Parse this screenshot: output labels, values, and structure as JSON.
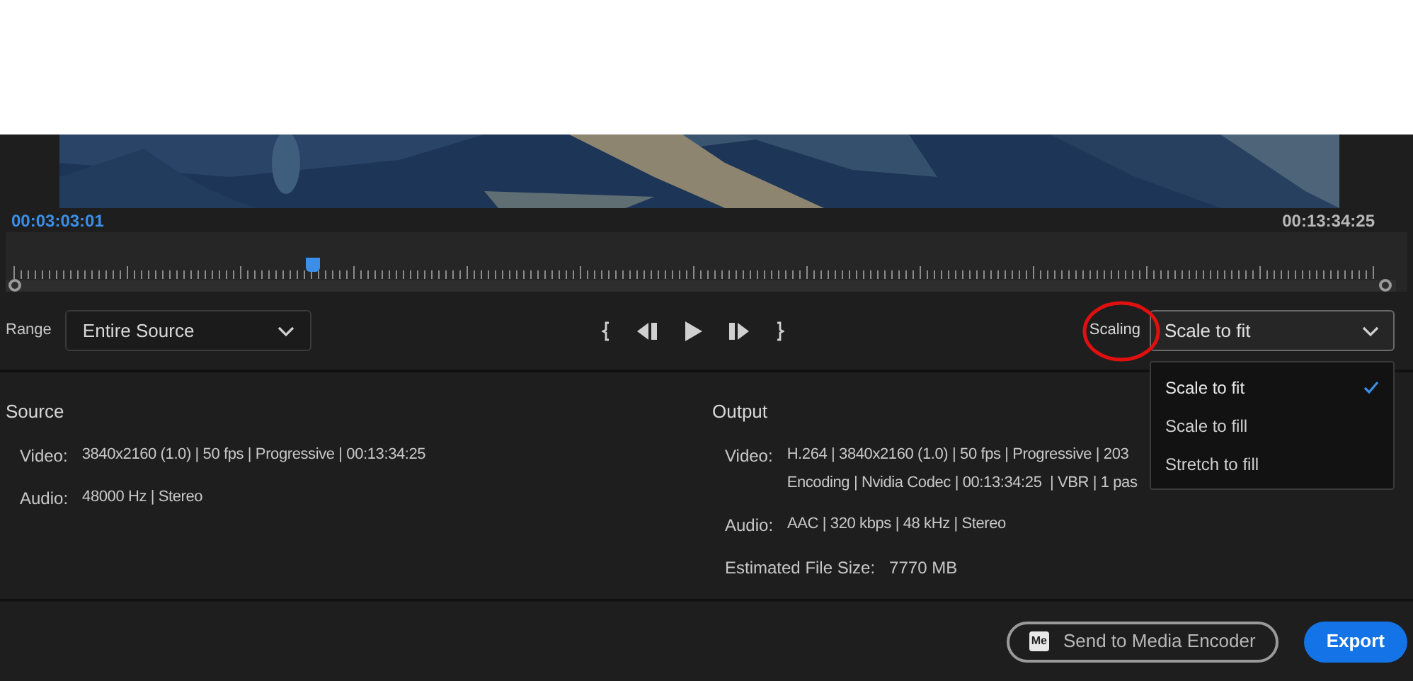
{
  "timeline": {
    "current_time": "00:03:03:01",
    "duration": "00:13:34:25",
    "level": 0.22
  },
  "range": {
    "label": "Range",
    "value": "Entire Source"
  },
  "scaling": {
    "label": "Scaling",
    "value": "Scale to fit",
    "expanded": true,
    "options": [
      {
        "label": "Scale to fit",
        "selected": true
      },
      {
        "label": "Scale to fill",
        "selected": false
      },
      {
        "label": "Stretch to fill",
        "selected": false
      }
    ]
  },
  "source": {
    "title": "Source",
    "rows": [
      {
        "label": "Video:",
        "lines": [
          "3840x2160 (1.0) | 50 fps | Progressive | 00:13:34:25"
        ]
      },
      {
        "label": "Audio:",
        "lines": [
          "48000 Hz | Stereo"
        ]
      }
    ]
  },
  "output": {
    "title": "Output",
    "rows": [
      {
        "label": "Video:",
        "lines": [
          "H.264 | 3840x2160 (1.0) | 50 fps | Progressive | 203",
          "Encoding | Nvidia Codec | 00:13:34:25  | VBR | 1 pas"
        ]
      },
      {
        "label": "Audio:",
        "lines": [
          "AAC | 320 kbps | 48 kHz | Stereo"
        ]
      }
    ],
    "file_size": {
      "label": "Estimated File Size:",
      "value": "7770 MB"
    }
  },
  "footer": {
    "media_encoder_badge": "Me",
    "send_button": "Send to Media Encoder",
    "export_button": "Export"
  }
}
